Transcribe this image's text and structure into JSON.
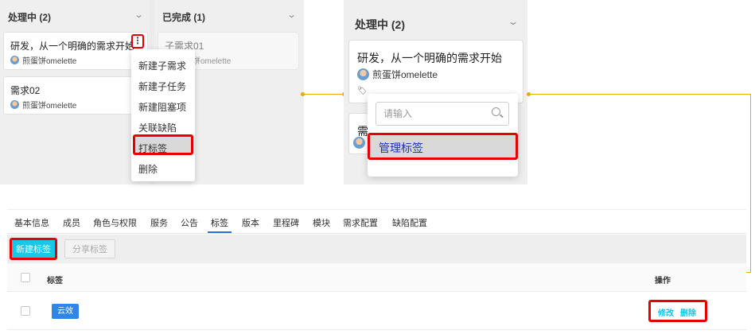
{
  "kanban": {
    "columns": [
      {
        "title": "处理中 (2)"
      },
      {
        "title": "已完成 (1)"
      }
    ],
    "cards": [
      {
        "title": "研发，从一个明确的需求开始",
        "user": "煎蛋饼omelette"
      },
      {
        "title": "需求02",
        "user": "煎蛋饼omelette"
      },
      {
        "title": "子需求01",
        "user": "煎蛋饼omelette"
      }
    ],
    "more_glyph": "⋮",
    "context_menu": [
      "新建子需求",
      "新建子任务",
      "新建阻塞项",
      "关联缺陷",
      "打标签",
      "删除"
    ]
  },
  "tag_popover": {
    "column_title": "处理中 (2)",
    "card_title": "研发，从一个明确的需求开始",
    "card_user": "煎蛋饼omelette",
    "second_card_title": "需",
    "search_placeholder": "请输入",
    "manage_label": "管理标签"
  },
  "settings": {
    "tabs": [
      "基本信息",
      "成员",
      "角色与权限",
      "服务",
      "公告",
      "标签",
      "版本",
      "里程碑",
      "模块",
      "需求配置",
      "缺陷配置"
    ],
    "active_tab": "标签",
    "new_button": "新建标签",
    "share_button": "分享标签",
    "columns": {
      "tag": "标签",
      "actions": "操作"
    },
    "rows": [
      {
        "tag": "云效",
        "edit": "修改",
        "delete": "删除"
      }
    ]
  },
  "colors": {
    "accent": "#18c8e8",
    "highlight_border": "#e60000",
    "connector": "#f0a800",
    "tag_blue": "#2f86e6"
  }
}
